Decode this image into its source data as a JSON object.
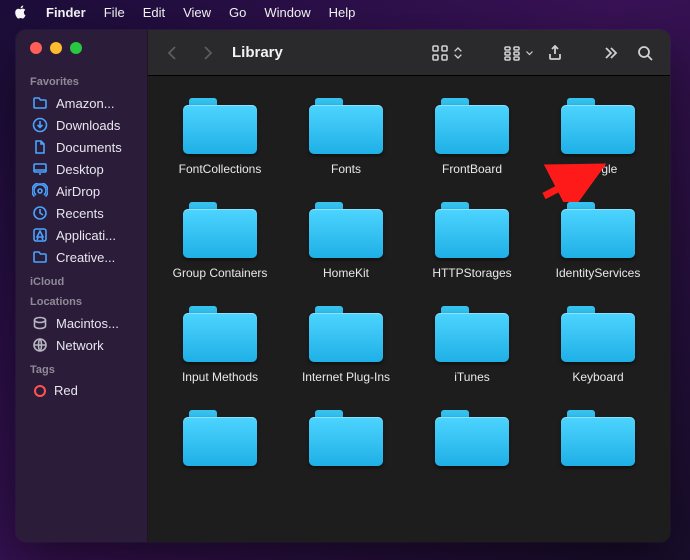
{
  "menubar": {
    "app": "Finder",
    "items": [
      "File",
      "Edit",
      "View",
      "Go",
      "Window",
      "Help"
    ]
  },
  "window": {
    "title": "Library"
  },
  "sidebar": {
    "sections": [
      {
        "heading": "Favorites",
        "items": [
          {
            "icon": "folder",
            "label": "Amazon..."
          },
          {
            "icon": "download",
            "label": "Downloads"
          },
          {
            "icon": "document",
            "label": "Documents"
          },
          {
            "icon": "desktop",
            "label": "Desktop"
          },
          {
            "icon": "airdrop",
            "label": "AirDrop"
          },
          {
            "icon": "clock",
            "label": "Recents"
          },
          {
            "icon": "appstore",
            "label": "Applicati..."
          },
          {
            "icon": "folder",
            "label": "Creative..."
          }
        ]
      },
      {
        "heading": "iCloud",
        "items": []
      },
      {
        "heading": "Locations",
        "items": [
          {
            "icon": "disk",
            "label": "Macintos...",
            "gray": true
          },
          {
            "icon": "globe",
            "label": "Network",
            "gray": true
          }
        ]
      },
      {
        "heading": "Tags",
        "items": [
          {
            "icon": "tag-red",
            "label": "Red"
          }
        ]
      }
    ]
  },
  "folders": [
    "FontCollections",
    "Fonts",
    "FrontBoard",
    "Google",
    "Group Containers",
    "HomeKit",
    "HTTPStorages",
    "IdentityServices",
    "Input Methods",
    "Internet Plug-Ins",
    "iTunes",
    "Keyboard",
    "",
    "",
    "",
    ""
  ],
  "annotation": {
    "target_index": 3,
    "color": "#ff1a1a"
  }
}
